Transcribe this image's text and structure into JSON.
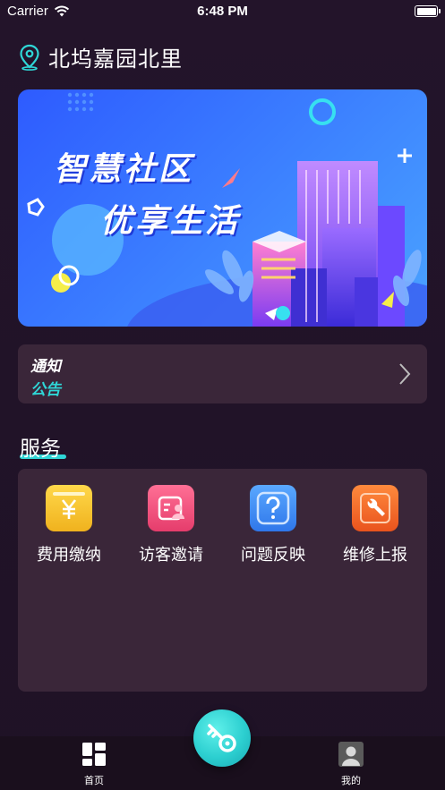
{
  "status_bar": {
    "carrier": "Carrier",
    "time": "6:48 PM"
  },
  "header": {
    "location": "北坞嘉园北里",
    "icon": "location-pin-icon"
  },
  "banner": {
    "title": "智慧社区",
    "subtitle": "优享生活"
  },
  "notice": {
    "label_top": "通知",
    "label_bottom": "公告"
  },
  "services": {
    "title": "服务",
    "items": [
      {
        "label": "费用缴纳",
        "icon": "yuan-icon",
        "color": "#f7c531"
      },
      {
        "label": "访客邀请",
        "icon": "visitor-card-icon",
        "color": "#f0527a"
      },
      {
        "label": "问题反映",
        "icon": "question-icon",
        "color": "#3d8cf5"
      },
      {
        "label": "维修上报",
        "icon": "wrench-icon",
        "color": "#f26a2b"
      }
    ]
  },
  "tabbar": {
    "home_label": "首页",
    "mine_label": "我的"
  },
  "colors": {
    "background": "#221428",
    "card": "#3a2639",
    "accent": "#2fd6d6"
  }
}
